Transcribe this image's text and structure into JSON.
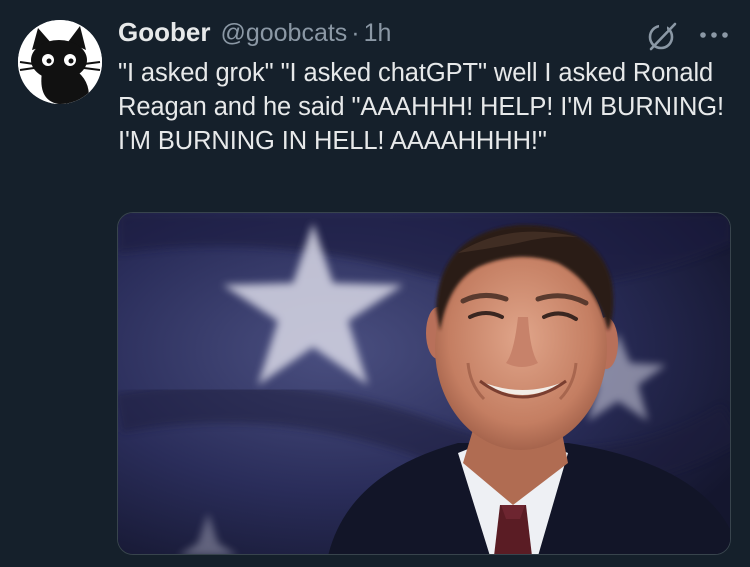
{
  "post": {
    "author": {
      "display_name": "Goober",
      "handle": "@goobcats",
      "separator": "·",
      "timestamp": "1h",
      "avatar_icon": "black-cat-avatar"
    },
    "actions": {
      "grok_icon": "grok-icon",
      "more_icon": "more-options-icon"
    },
    "text": "\"I asked grok\" \"I asked chatGPT\" well I asked Ronald Reagan and he said \"AAAHHH! HELP! I'M BURNING! I'M BURNING IN HELL! AAAAHHHH!\"",
    "media": {
      "kind": "photo",
      "subject": "portrait-in-front-of-flag"
    }
  },
  "colors": {
    "background": "#15202b",
    "primary_text": "#e7e9ea",
    "secondary_text": "#8b98a5",
    "border": "#38444d"
  }
}
